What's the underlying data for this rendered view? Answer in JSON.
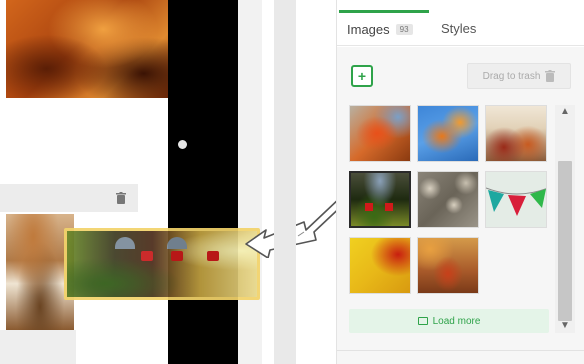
{
  "panel": {
    "tabs": [
      {
        "label": "Images",
        "count": "93",
        "active": true
      },
      {
        "label": "Styles",
        "active": false
      }
    ],
    "add_icon": "plus",
    "trash_button": {
      "label": "Drag to trash",
      "icon": "trash-icon"
    },
    "load_more": {
      "label": "Load more",
      "icon": "image-icon"
    },
    "thumbnails": [
      {
        "subject": "autumn leaves on branch"
      },
      {
        "subject": "orange leaves against blue sky"
      },
      {
        "subject": "autumn table setting"
      },
      {
        "subject": "garden lanterns"
      },
      {
        "subject": "pebbles"
      },
      {
        "subject": "bunting flags"
      },
      {
        "subject": "red leaf on yellow"
      },
      {
        "subject": "fallen leaf on ground"
      }
    ]
  },
  "colors": {
    "accent": "#2fa34a",
    "drag_frame": "#f2d36a",
    "bunting": [
      "#1ea8a0",
      "#d81e3a",
      "#2fb84a"
    ]
  }
}
